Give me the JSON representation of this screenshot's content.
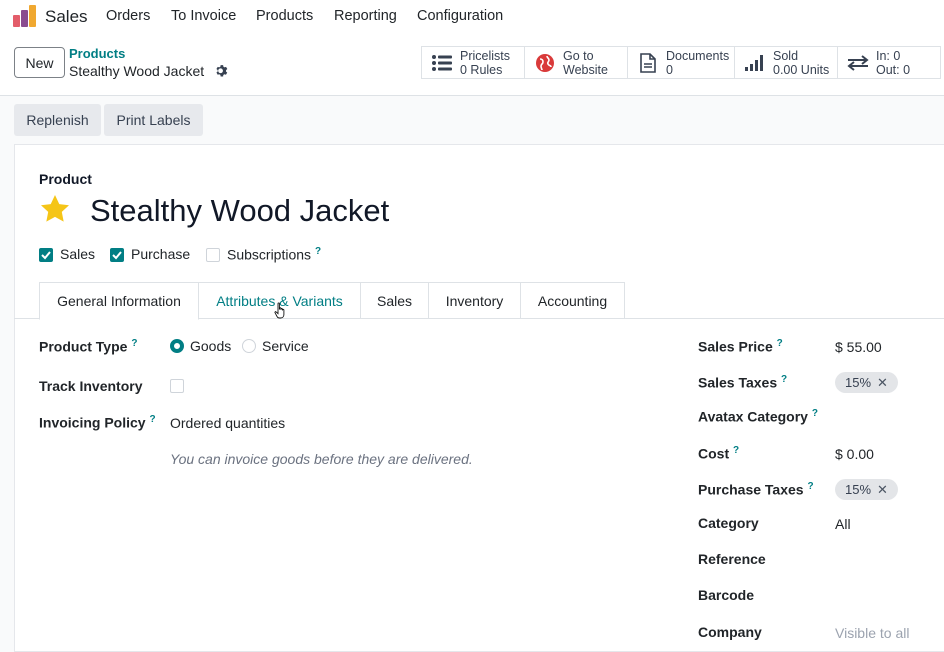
{
  "app": {
    "name": "Sales"
  },
  "menu": [
    "Orders",
    "To Invoice",
    "Products",
    "Reporting",
    "Configuration"
  ],
  "control_panel": {
    "new_label": "New",
    "breadcrumb_parent": "Products",
    "breadcrumb_current": "Stealthy Wood Jacket"
  },
  "smart_buttons": [
    {
      "icon": "list-icon",
      "line1": "Pricelists",
      "line2": "0 Rules"
    },
    {
      "icon": "globe-icon",
      "line1": "Go to",
      "line2": "Website"
    },
    {
      "icon": "document-icon",
      "line1": "Documents",
      "line2": "0"
    },
    {
      "icon": "signal-bars-icon",
      "line1": "Sold",
      "line2": "0.00 Units"
    },
    {
      "icon": "transfer-arrows-icon",
      "line1": "In: 0",
      "line2": "Out: 0"
    }
  ],
  "actions": {
    "replenish": "Replenish",
    "print_labels": "Print Labels"
  },
  "product": {
    "label": "Product",
    "name": "Stealthy Wood Jacket",
    "starred": true,
    "checks": [
      {
        "label": "Sales",
        "checked": true,
        "help": ""
      },
      {
        "label": "Purchase",
        "checked": true,
        "help": ""
      },
      {
        "label": "Subscriptions",
        "checked": false,
        "help": "?"
      }
    ]
  },
  "tabs": [
    "General Information",
    "Attributes & Variants",
    "Sales",
    "Inventory",
    "Accounting"
  ],
  "active_tab": "General Information",
  "general": {
    "product_type_label": "Product Type",
    "product_type_options": [
      "Goods",
      "Service"
    ],
    "product_type_value": "Goods",
    "track_inventory_label": "Track Inventory",
    "track_inventory_checked": false,
    "invoicing_policy_label": "Invoicing Policy",
    "invoicing_policy_value": "Ordered quantities",
    "invoicing_hint": "You can invoice goods before they are delivered.",
    "help_mark": "?"
  },
  "right_fields": {
    "sales_price_label": "Sales Price",
    "sales_price_value": "$ 55.00",
    "sales_taxes_label": "Sales Taxes",
    "sales_taxes_tag": "15%",
    "avatax_label": "Avatax Category",
    "cost_label": "Cost",
    "cost_value": "$ 0.00",
    "purchase_taxes_label": "Purchase Taxes",
    "purchase_taxes_tag": "15%",
    "category_label": "Category",
    "category_value": "All",
    "reference_label": "Reference",
    "barcode_label": "Barcode",
    "company_label": "Company",
    "company_placeholder": "Visible to all",
    "tag_remove": "✕"
  },
  "colors": {
    "accent": "#017e84",
    "star": "#f5c518",
    "globe": "#d93a3a"
  }
}
